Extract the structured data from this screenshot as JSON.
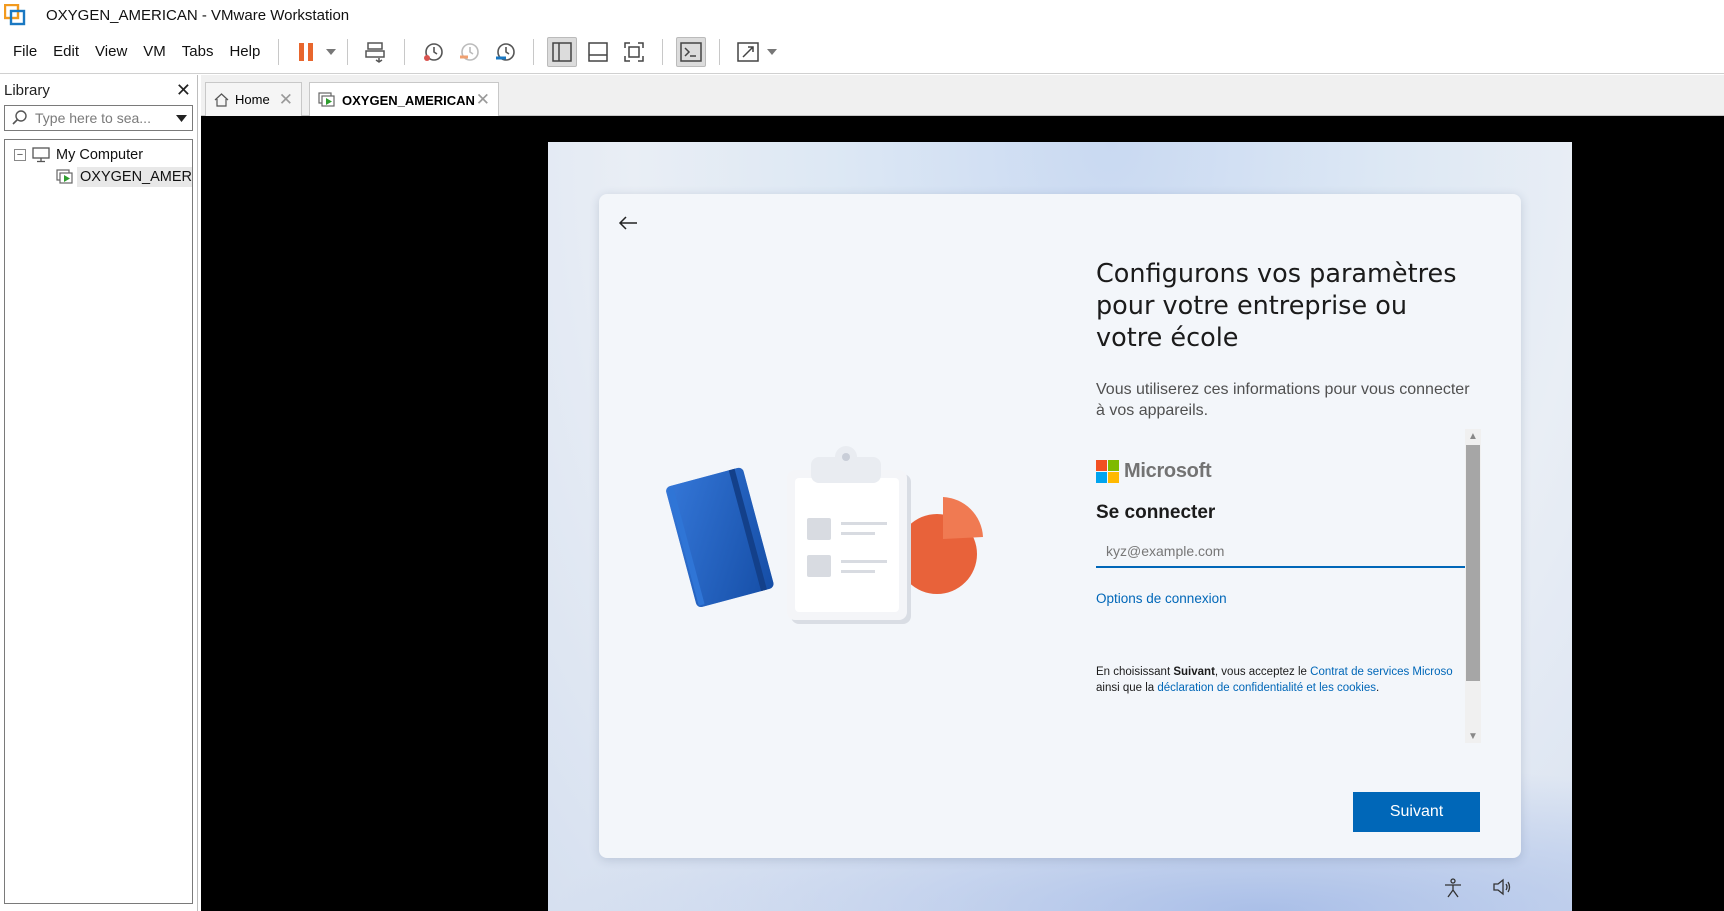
{
  "window": {
    "title": "OXYGEN_AMERICAN - VMware Workstation"
  },
  "menu": {
    "items": [
      "File",
      "Edit",
      "View",
      "VM",
      "Tabs",
      "Help"
    ]
  },
  "library": {
    "title": "Library",
    "search_placeholder": "Type here to sea...",
    "tree": {
      "root": "My Computer",
      "child": "OXYGEN_AMERIC"
    }
  },
  "tabs": [
    {
      "label": "Home"
    },
    {
      "label": "OXYGEN_AMERICAN"
    }
  ],
  "oobe": {
    "heading": "Configurons vos paramètres pour votre entreprise ou votre école",
    "subtext": "Vous utiliserez ces informations pour vous connecter à vos appareils.",
    "brand": "Microsoft",
    "signin_title": "Se connecter",
    "email_placeholder": "kyz@example.com",
    "options_link": "Options de connexion",
    "legal": {
      "prefix": "En choisissant ",
      "bold": "Suivant",
      "middle": ", vous acceptez le ",
      "link1": "Contrat de services Microso",
      "line2_prefix": "ainsi que la ",
      "link2": "déclaration de confidentialité et les cookies",
      "suffix": "."
    },
    "next_label": "Suivant"
  },
  "colors": {
    "accent": "#0067b8",
    "pause": "#e8662d",
    "vm_bg": "#000000"
  }
}
